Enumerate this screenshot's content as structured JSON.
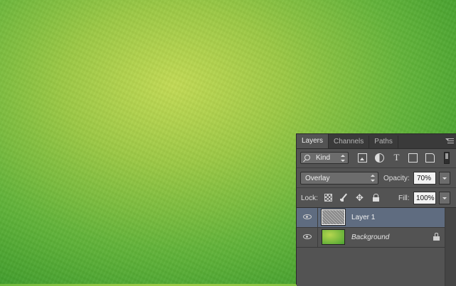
{
  "canvas": {
    "description_colors": {
      "center": "#c3da55",
      "edge": "#2e8824"
    }
  },
  "panel": {
    "tabs": [
      {
        "label": "Layers",
        "active": true
      },
      {
        "label": "Channels",
        "active": false
      },
      {
        "label": "Paths",
        "active": false
      }
    ],
    "filter": {
      "kind_label": "Kind",
      "icons": [
        "pixel-layer-filter-icon",
        "adjustment-layer-filter-icon",
        "type-layer-filter-icon",
        "shape-layer-filter-icon",
        "smart-object-filter-icon"
      ],
      "text_glyph": "T"
    },
    "blend": {
      "mode": "Overlay",
      "opacity_label": "Opacity:",
      "opacity_value": "70%"
    },
    "lock": {
      "label": "Lock:",
      "move_glyph": "✥",
      "fill_label": "Fill:",
      "fill_value": "100%"
    },
    "layers": [
      {
        "name": "Layer 1",
        "selected": true,
        "visible": true
      },
      {
        "name": "Background",
        "selected": false,
        "visible": true,
        "locked": true
      }
    ],
    "colors": {
      "panel_bg": "#535353",
      "selected_row": "#5f6c80"
    }
  }
}
